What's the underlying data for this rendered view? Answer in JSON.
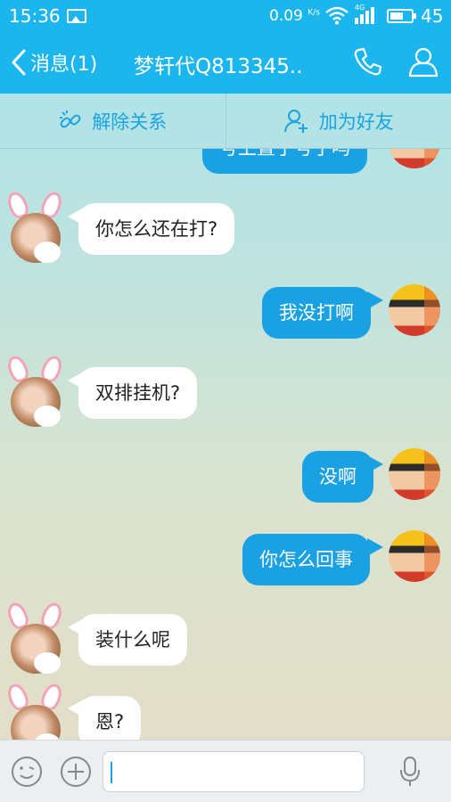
{
  "status_bar": {
    "time": "15:36",
    "speed": "0.09",
    "speed_unit": "K/s",
    "network": "4G",
    "battery": "45"
  },
  "nav": {
    "back_label": "消息(1)",
    "title": "梦轩代Q813345..",
    "phone_icon": "phone-icon",
    "profile_icon": "person-icon"
  },
  "actions": {
    "unbind_label": "解除关系",
    "unbind_icon": "link-break-icon",
    "add_friend_label": "加为好友",
    "add_friend_icon": "person-add-icon"
  },
  "messages": [
    {
      "from": "me",
      "text": "号上置了号了吗"
    },
    {
      "from": "them",
      "text": "你怎么还在打?"
    },
    {
      "from": "me",
      "text": "我没打啊"
    },
    {
      "from": "them",
      "text": "双排挂机?"
    },
    {
      "from": "me",
      "text": "没啊"
    },
    {
      "from": "me",
      "text": "你怎么回事"
    },
    {
      "from": "them",
      "text": "装什么呢"
    },
    {
      "from": "them",
      "text": "恩?"
    }
  ],
  "input": {
    "value": "",
    "emoji_icon": "emoji-icon",
    "plus_icon": "plus-icon",
    "mic_icon": "microphone-icon"
  },
  "colors": {
    "header": "#1cb6ee",
    "bubble_out": "#1aa1e4",
    "bubble_in": "#ffffff",
    "accent_text": "#1aa4e0"
  }
}
